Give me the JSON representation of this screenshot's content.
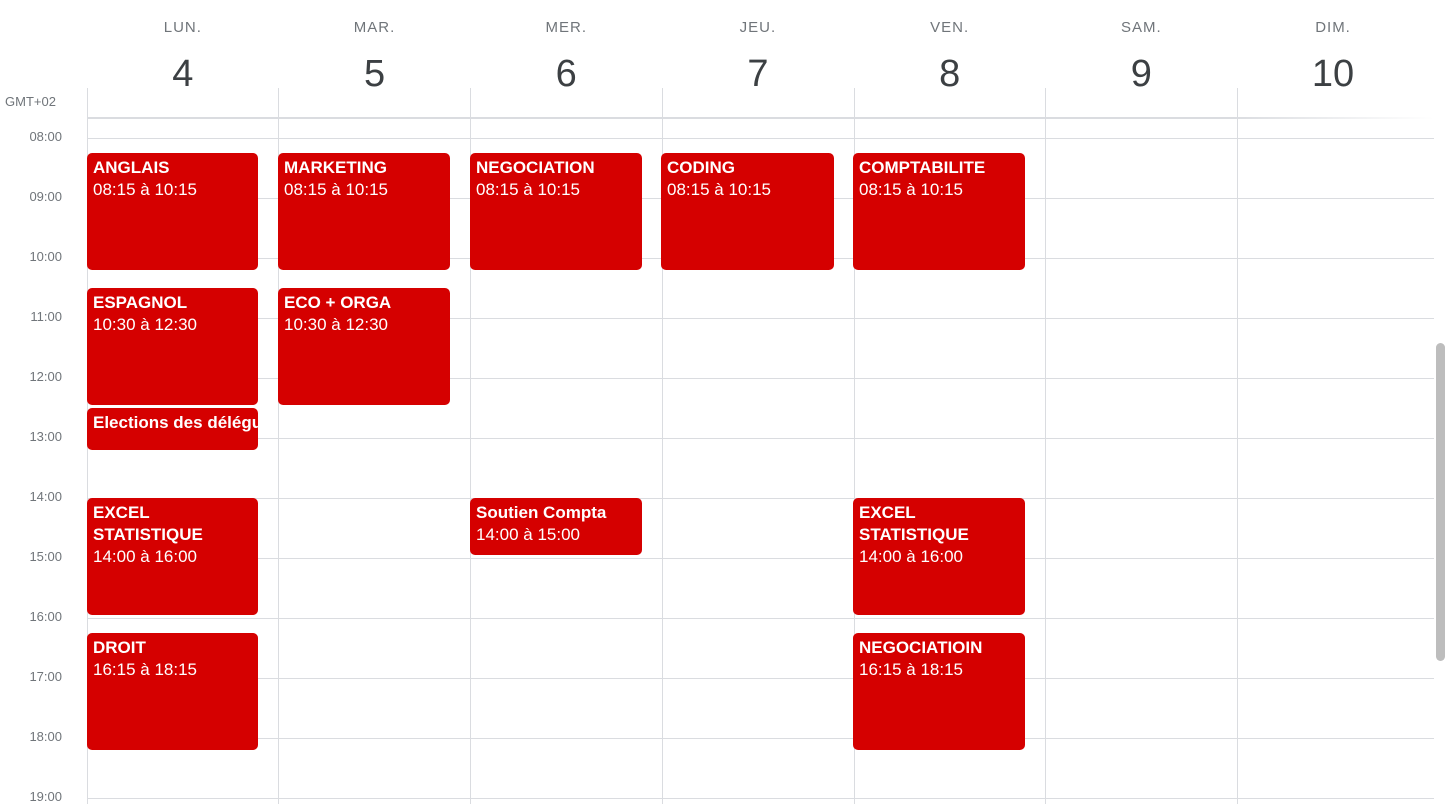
{
  "timezone": "GMT+02",
  "days": [
    {
      "name": "LUN.",
      "num": "4"
    },
    {
      "name": "MAR.",
      "num": "5"
    },
    {
      "name": "MER.",
      "num": "6"
    },
    {
      "name": "JEU.",
      "num": "7"
    },
    {
      "name": "VEN.",
      "num": "8"
    },
    {
      "name": "SAM.",
      "num": "9"
    },
    {
      "name": "DIM.",
      "num": "10"
    }
  ],
  "hours": [
    "08:00",
    "09:00",
    "10:00",
    "11:00",
    "12:00",
    "13:00",
    "14:00",
    "15:00",
    "16:00",
    "17:00",
    "18:00",
    "19:00"
  ],
  "events": {
    "lun_anglais": {
      "title": "ANGLAIS",
      "time": "08:15 à 10:15"
    },
    "lun_espagnol": {
      "title": "ESPAGNOL",
      "time": "10:30 à 12:30"
    },
    "lun_elections": {
      "title": "Elections des délégués"
    },
    "lun_excel": {
      "title": "EXCEL STATISTIQUE",
      "time": "14:00 à 16:00"
    },
    "lun_droit": {
      "title": "DROIT",
      "time": "16:15 à 18:15"
    },
    "mar_marketing": {
      "title": "MARKETING",
      "time": "08:15 à 10:15"
    },
    "mar_eco": {
      "title": "ECO + ORGA",
      "time": "10:30 à 12:30"
    },
    "mer_negociation": {
      "title": "NEGOCIATION",
      "time": "08:15 à 10:15"
    },
    "mer_soutien": {
      "title": "Soutien Compta",
      "time": "14:00 à 15:00"
    },
    "jeu_coding": {
      "title": "CODING",
      "time": "08:15 à 10:15"
    },
    "ven_compta": {
      "title": "COMPTABILITE",
      "time": "08:15 à 10:15"
    },
    "ven_excel": {
      "title": "EXCEL STATISTIQUE",
      "time": "14:00 à 16:00"
    },
    "ven_negociatioin": {
      "title": "NEGOCIATIOIN",
      "time": "16:15 à 18:15"
    }
  }
}
